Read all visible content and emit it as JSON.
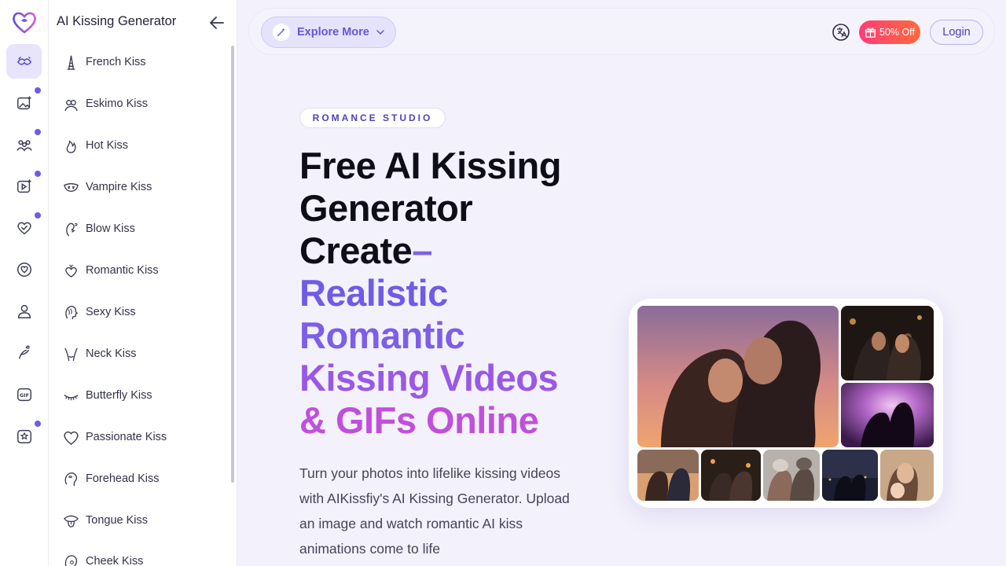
{
  "sidebar": {
    "title": "AI Kissing Generator",
    "rail_icons": [
      "kiss-lips-icon",
      "image-sparkle-icon",
      "group-icon",
      "video-sparkle-icon",
      "heart-check-icon",
      "heart-chat-icon",
      "avatar-icon",
      "pose-icon",
      "gif-icon",
      "star-frame-icon"
    ],
    "items": [
      {
        "label": "French Kiss",
        "icon": "eiffel-tower-icon"
      },
      {
        "label": "Eskimo Kiss",
        "icon": "couple-icon"
      },
      {
        "label": "Hot Kiss",
        "icon": "flame-icon"
      },
      {
        "label": "Vampire Kiss",
        "icon": "fangs-icon"
      },
      {
        "label": "Blow Kiss",
        "icon": "blow-kiss-icon"
      },
      {
        "label": "Romantic Kiss",
        "icon": "heart-hands-icon"
      },
      {
        "label": "Sexy Kiss",
        "icon": "face-profile-icon"
      },
      {
        "label": "Neck Kiss",
        "icon": "neck-icon"
      },
      {
        "label": "Butterfly Kiss",
        "icon": "eyelash-icon"
      },
      {
        "label": "Passionate Kiss",
        "icon": "heart-outline-icon"
      },
      {
        "label": "Forehead Kiss",
        "icon": "head-icon"
      },
      {
        "label": "Tongue Kiss",
        "icon": "tongue-icon"
      },
      {
        "label": "Cheek Kiss",
        "icon": "cheek-icon"
      }
    ]
  },
  "header": {
    "explore_label": "Explore More",
    "promo_label": "50% Off",
    "login_label": "Login"
  },
  "hero": {
    "badge": "ROMANCE STUDIO",
    "title_line1": "Free AI Kissing",
    "title_line2": "Generator",
    "title_line3": "Create",
    "title_dash": "–",
    "title_line4": "Realistic",
    "title_line5": "Romantic",
    "title_line6": "Kissing Videos",
    "title_line7": "& GIFs Online",
    "description": "Turn your photos into lifelike kissing videos with AIKissfiy's AI Kissing Generator. Upload an image and watch romantic AI kiss animations come to life"
  },
  "colors": {
    "accent": "#6d5ce8",
    "promo_start": "#ff3d77",
    "promo_end": "#ff6a3a",
    "page_bg": "#f3f1fb"
  }
}
